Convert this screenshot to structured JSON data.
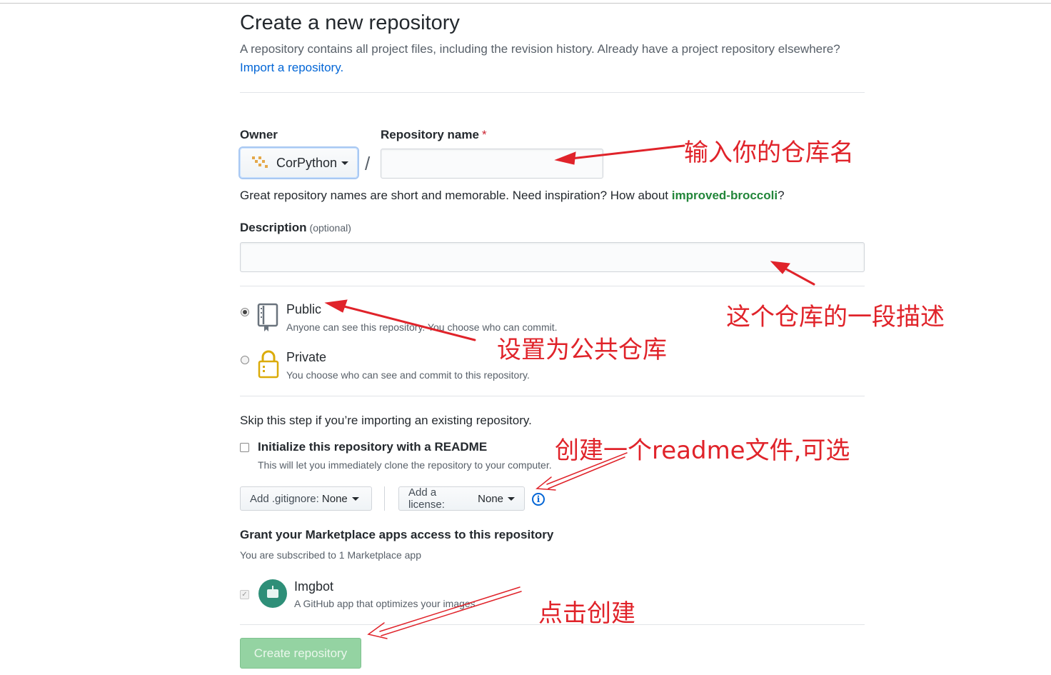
{
  "header": {
    "title": "Create a new repository",
    "subtitle": "A repository contains all project files, including the revision history. Already have a project repository elsewhere?",
    "import_link": "Import a repository."
  },
  "owner": {
    "label": "Owner",
    "value": "CorPython"
  },
  "repo_name": {
    "label": "Repository name",
    "required_mark": "*",
    "value": "",
    "separator": "/"
  },
  "name_hint": {
    "text": "Great repository names are short and memorable. Need inspiration? How about ",
    "suggestion": "improved-broccoli",
    "end": "?"
  },
  "description": {
    "label": "Description",
    "optional": "(optional)",
    "value": ""
  },
  "visibility": {
    "public": {
      "title": "Public",
      "desc": "Anyone can see this repository. You choose who can commit.",
      "checked": true
    },
    "private": {
      "title": "Private",
      "desc": "You choose who can see and commit to this repository.",
      "checked": false
    }
  },
  "init": {
    "skip_text": "Skip this step if you’re importing an existing repository.",
    "readme_title": "Initialize this repository with a README",
    "readme_desc": "This will let you immediately clone the repository to your computer.",
    "readme_checked": false
  },
  "gitignore": {
    "label": "Add .gitignore:",
    "value": "None"
  },
  "license": {
    "label": "Add a license:",
    "value": "None"
  },
  "marketplace": {
    "title": "Grant your Marketplace apps access to this repository",
    "subtitle": "You are subscribed to 1 Marketplace app",
    "app_name": "Imgbot",
    "app_desc": "A GitHub app that optimizes your images"
  },
  "create_button": "Create repository",
  "annotations": {
    "repo_name": "输入你的仓库名",
    "description": "这个仓库的一段描述",
    "public": "设置为公共仓库",
    "readme": "创建一个readme文件,可选",
    "create": "点击创建"
  },
  "colors": {
    "annotation_red": "#e0232a",
    "link_blue": "#0366d6",
    "suggestion_green": "#22863a",
    "create_button_bg": "#94d3a2"
  },
  "icons": {
    "public": "repo-icon",
    "private": "lock-icon",
    "info": "info-icon",
    "app": "imgbot-icon"
  }
}
